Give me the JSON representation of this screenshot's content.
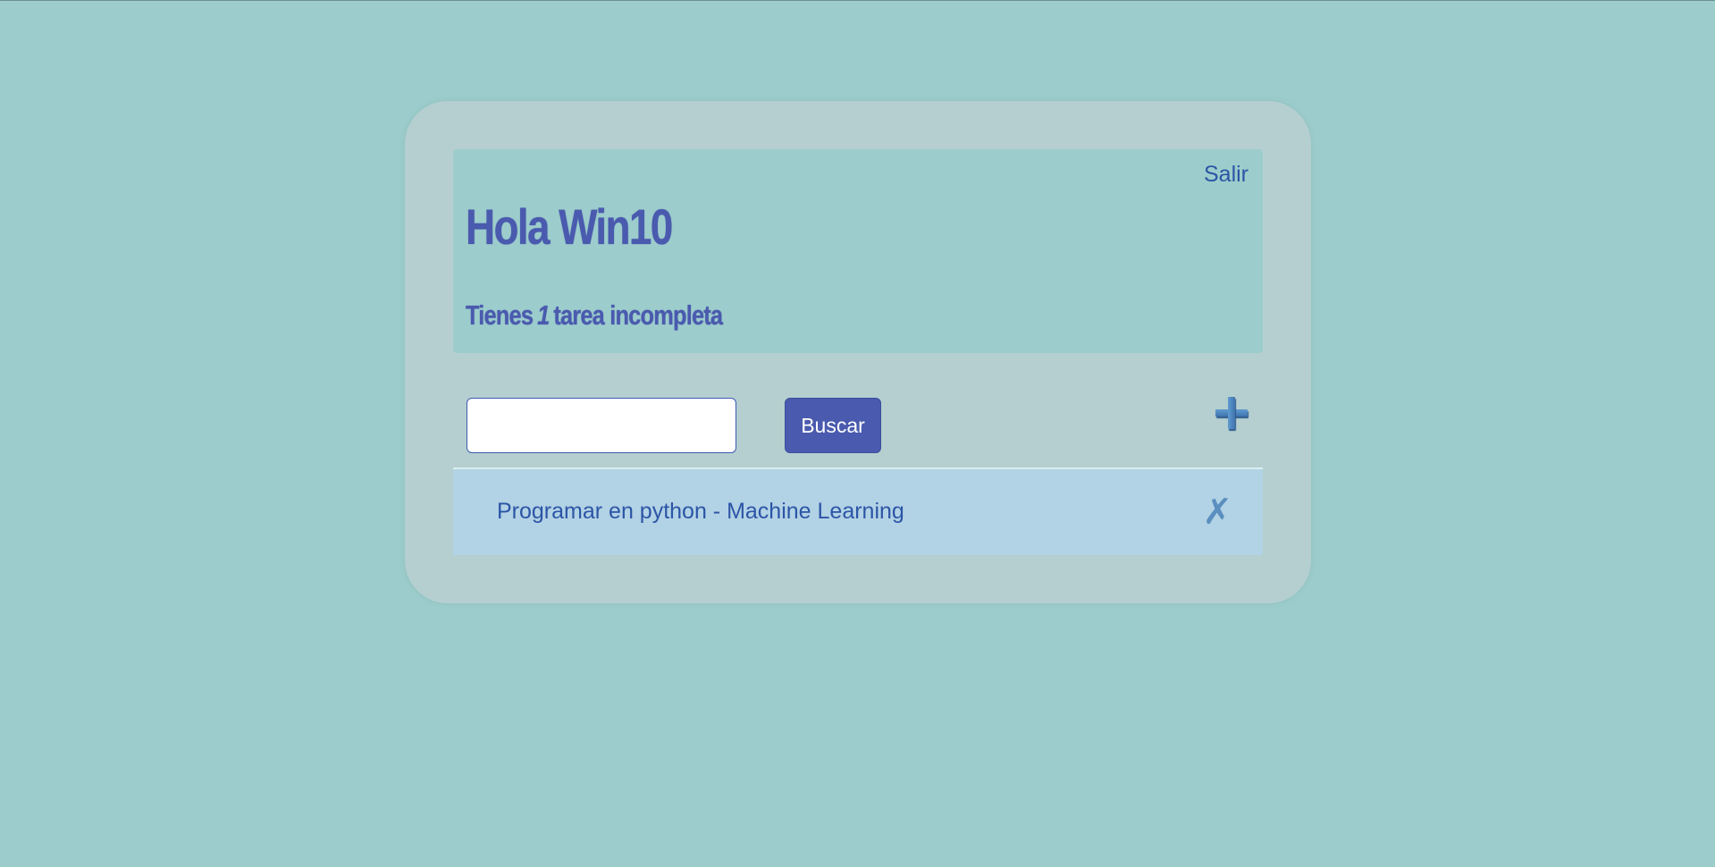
{
  "header": {
    "logout_label": "Salir",
    "greeting": "Hola Win10",
    "pending_prefix": "Tienes",
    "pending_count": "1",
    "pending_suffix": "tarea incompleta"
  },
  "search": {
    "value": "",
    "placeholder": "",
    "button_label": "Buscar"
  },
  "icons": {
    "add": "plus-icon",
    "delete": "close-icon",
    "delete_glyph": "✗"
  },
  "tasks": [
    {
      "text": "Programar en python - Machine Learning"
    }
  ],
  "colors": {
    "background": "#9ccdcc",
    "card": "#b5cfd0",
    "accent": "#4a5aae",
    "link": "#2c55a6",
    "task_row": "#b2d2e5"
  }
}
